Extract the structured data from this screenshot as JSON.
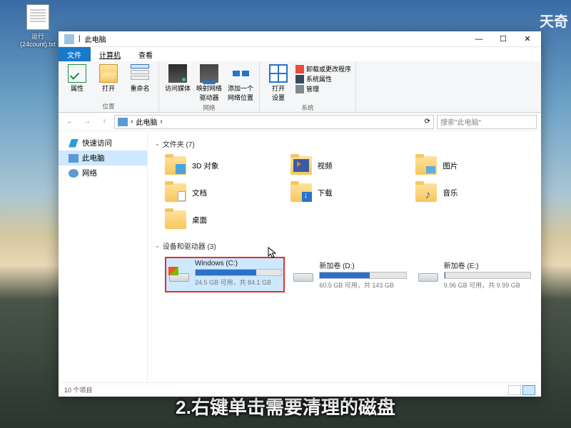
{
  "desktop_icon": {
    "line1": "运行",
    "line2": "(24count).txt"
  },
  "watermark": "天奇",
  "subtitle_text": "2.右键单击需要清理的磁盘",
  "titlebar": {
    "title": "此电脑",
    "sep": "|",
    "min": "—",
    "max": "☐",
    "close": "✕"
  },
  "ribbon_tabs": {
    "file": "文件",
    "computer": "计算机",
    "view": "查看"
  },
  "ribbon": {
    "g1": {
      "label": "位置",
      "props": "属性",
      "open": "打开",
      "rename": "重命名"
    },
    "g2": {
      "label": "网络",
      "media": "访问媒体",
      "mapdrv": "映射网络\n驱动器",
      "addloc": "添加一个\n网络位置"
    },
    "g3": {
      "label": "系统",
      "open_settings": "打开\n设置",
      "uninstall": "卸载或更改程序",
      "sysprops": "系统属性",
      "manage": "管理"
    }
  },
  "addr": {
    "back": "←",
    "fwd": "→",
    "up": "↑",
    "crumb": "此电脑",
    "sep": "›",
    "refresh": "⟳",
    "search_ph": "搜索\"此电脑\""
  },
  "nav": {
    "quick": "快速访问",
    "pc": "此电脑",
    "net": "网络"
  },
  "sections": {
    "folders_hdr": "文件夹 (7)",
    "drives_hdr": "设备和驱动器 (3)",
    "folders": [
      {
        "name": "3D 对象",
        "cls": "fi-3d"
      },
      {
        "name": "视频",
        "cls": "fi-vid"
      },
      {
        "name": "图片",
        "cls": "fi-pic"
      },
      {
        "name": "文档",
        "cls": "fi-doc"
      },
      {
        "name": "下载",
        "cls": "fi-dl"
      },
      {
        "name": "音乐",
        "cls": "fi-mus"
      },
      {
        "name": "桌面",
        "cls": ""
      }
    ],
    "drives": [
      {
        "name": "Windows (C:)",
        "sub": "24.5 GB 可用，共 84.1 GB",
        "pct": 71,
        "highlight": true,
        "win": true
      },
      {
        "name": "新加卷 (D:)",
        "sub": "60.5 GB 可用，共 143 GB",
        "pct": 58,
        "highlight": false,
        "win": false
      },
      {
        "name": "新加卷 (E:)",
        "sub": "9.96 GB 可用，共 9.99 GB",
        "pct": 1,
        "highlight": false,
        "win": false
      }
    ]
  },
  "status": {
    "count": "10 个项目"
  }
}
